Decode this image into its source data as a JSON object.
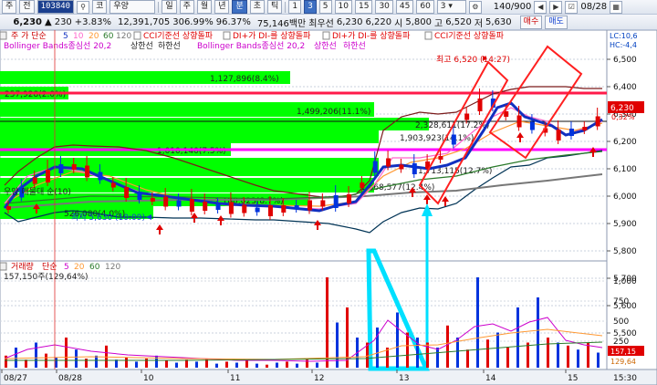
{
  "toolbar1": {
    "code_prefix_a": "주",
    "code_prefix_b": "전",
    "code": "103840",
    "market": "코",
    "name": "우양",
    "periods": [
      "일",
      "주",
      "월",
      "년",
      "분",
      "초",
      "틱"
    ],
    "period_selected": "분",
    "numbers": [
      "1",
      "3",
      "5",
      "10",
      "15",
      "30",
      "45",
      "60"
    ],
    "number_selected": "3",
    "dropdown_value": "3",
    "count": "140/900",
    "date": "08/28"
  },
  "toolbar2": {
    "price": "6,230",
    "change_arrow": "▲",
    "change": "230",
    "change_pct": "+3.83%",
    "volume": "12,391,705",
    "vol_ratio": "306.99%",
    "strength": "96.37%",
    "amount": "75,146백만",
    "best_ask_label": "최우선",
    "best_ask": "6,230",
    "best_bid": "6,220",
    "open_label": "시",
    "open": "5,800",
    "high_label": "고",
    "high": "6,520",
    "low_label": "저",
    "low": "5,630",
    "buy_label": "매수",
    "sell_label": "매도"
  },
  "legend": {
    "line1_a": "주 가 단순",
    "ma": [
      "5",
      "10",
      "20",
      "60",
      "120"
    ],
    "line1_b": "CCI기준선 상향돌파",
    "line1_c": "DI+가 DI-를 상향돌파",
    "line1_d": "DI+가 DI-를 상향돌파",
    "line1_e": "CCI기준선 상향돌파",
    "line2_a": "Bollinger Bands종심선 20,2",
    "line2_b": "상한선",
    "line2_c": "하한선",
    "line2_d": "Bollinger Bands종심선 20,2",
    "line2_e": "상한선",
    "line2_f": "하한선",
    "hl1": "LC:10,6",
    "hl2": "HC:-4,4",
    "annot1": "우양 매물대 순(10)"
  },
  "annotations": {
    "high_note": "최고 6,520 (14:27)",
    "low_note": "최저 5,630 (10:09)"
  },
  "volume_profile": {
    "bars": [
      {
        "label": "1,127,896(8.4%)"
      },
      {
        "label": "257,928(2.0%)"
      },
      {
        "label": "1,499,206(11.1%)"
      },
      {
        "label": "2,328,611(17.2%)"
      },
      {
        "label": "1,903,923(14.1%)"
      },
      {
        "label": "1,010,140(7.5%)"
      },
      {
        "label": "1,713,115(12.7%)"
      },
      {
        "label": "1,668,577(12.4%)"
      },
      {
        "label": "1,180,023(8.7%)"
      },
      {
        "label": "526,080(4.0%)"
      }
    ]
  },
  "price_axis": {
    "ticks": [
      "6,500",
      "6,400",
      "6,300",
      "6,200",
      "6,100",
      "6,000",
      "5,900",
      "5,800",
      "5,700",
      "5,600",
      "5,500"
    ],
    "current": "6,230",
    "current_pct": "0,32%"
  },
  "volume_pane": {
    "legend_a": "거래량",
    "legend_b": "단순",
    "ma": [
      "5",
      "20",
      "60",
      "120"
    ],
    "info": "157,150주(129,64%)",
    "ticks": [
      "1,000",
      "750",
      "500",
      "250"
    ],
    "current_a": "157,15",
    "current_b": "129,64"
  },
  "time_axis": {
    "labels": [
      "08/27",
      "08/28",
      "10",
      "11",
      "12",
      "13",
      "14",
      "15"
    ],
    "time": "15:30"
  },
  "colors": {
    "profile": "#00ff00",
    "up": "#e00000",
    "down": "#0033dd",
    "bollinger_mid": "#7a1a1a",
    "magenta": "#ff00ff",
    "annotation": "#ff2020",
    "arrow": "#00e0ff"
  }
}
